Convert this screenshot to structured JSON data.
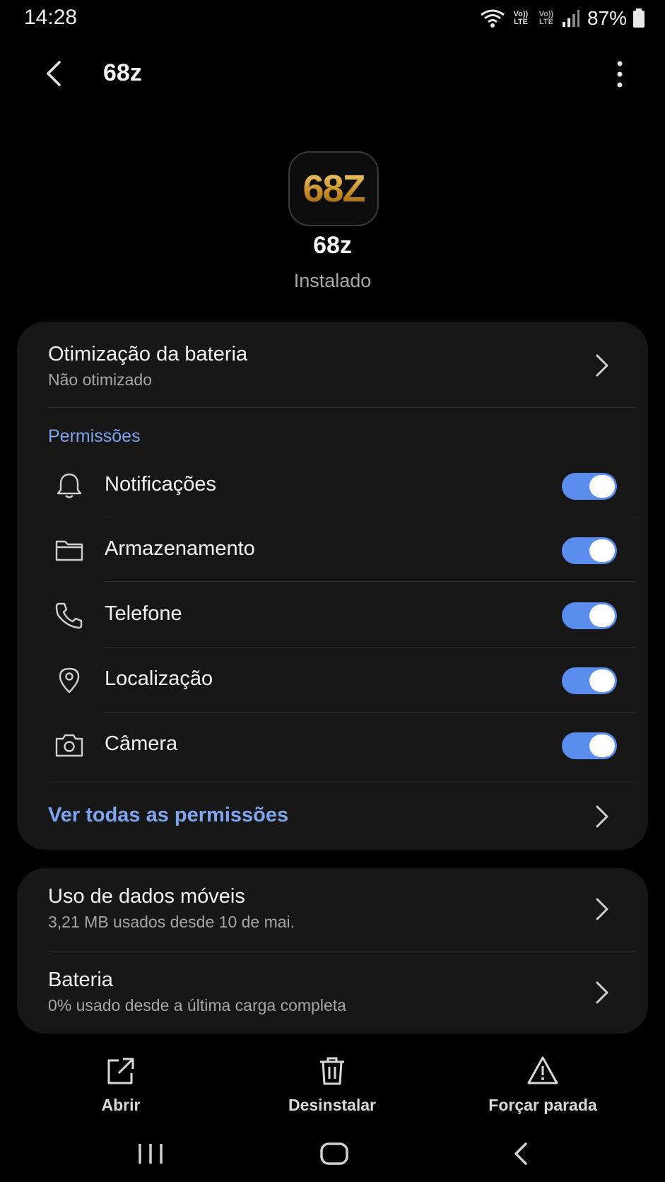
{
  "status_bar": {
    "time": "14:28",
    "volte1": "Vo)) LTE",
    "volte2": "Vo)) LTE",
    "battery": "87%"
  },
  "app_bar": {
    "title": "68z"
  },
  "header": {
    "icon_text": "68Z",
    "app_name": "68z",
    "status": "Instalado"
  },
  "battery_optimization": {
    "title": "Otimização da bateria",
    "subtitle": "Não otimizado"
  },
  "permissions": {
    "label": "Permissões",
    "items": [
      {
        "label": "Notificações",
        "icon": "bell-icon",
        "enabled": true
      },
      {
        "label": "Armazenamento",
        "icon": "folder-icon",
        "enabled": true
      },
      {
        "label": "Telefone",
        "icon": "phone-icon",
        "enabled": true
      },
      {
        "label": "Localização",
        "icon": "location-pin-icon",
        "enabled": true
      },
      {
        "label": "Câmera",
        "icon": "camera-icon",
        "enabled": true
      }
    ],
    "see_all": "Ver todas as permissões"
  },
  "usage": {
    "mobile_data": {
      "title": "Uso de dados móveis",
      "subtitle": "3,21 MB usados desde 10 de mai."
    },
    "battery": {
      "title": "Bateria",
      "subtitle": "0% usado desde a última carga completa"
    }
  },
  "actions": {
    "open": "Abrir",
    "uninstall": "Desinstalar",
    "force_stop": "Forçar parada"
  },
  "colors": {
    "accent": "#7ea6f0",
    "toggle_on": "#5b8def",
    "card_bg": "#171717",
    "background": "#000000"
  }
}
